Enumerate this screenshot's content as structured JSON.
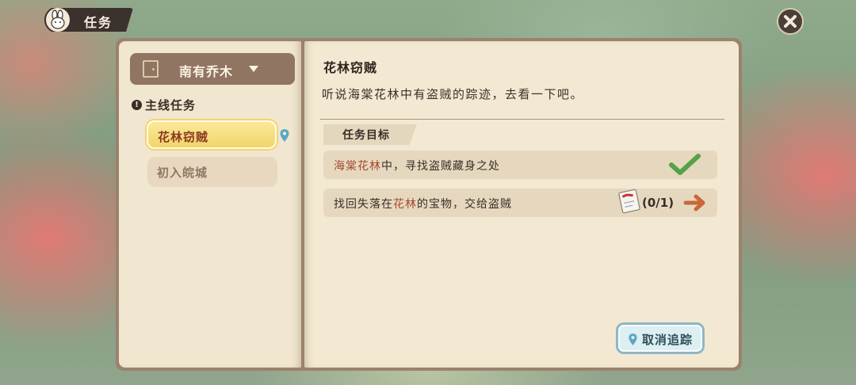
{
  "header": {
    "title": "任务"
  },
  "icons": {
    "header_avatar": "bunny-icon",
    "close": "close-icon",
    "area": "door-icon",
    "dropdown": "caret-down-icon",
    "section": "exclamation-icon",
    "tracked": "location-pin-icon",
    "completed": "checkmark-icon",
    "item": "scroll-icon",
    "go": "arrow-right-icon"
  },
  "colors": {
    "accent_gold": "#f1d56a",
    "check_green": "#58a04a",
    "highlight_red": "#a24a2e",
    "arrow_orange": "#c8683a"
  },
  "sidebar": {
    "area_selector": "南有乔木",
    "section_title": "主线任务",
    "quests": [
      {
        "label": "花林窃贼",
        "selected": true,
        "tracked": true
      },
      {
        "label": "初入皖城",
        "selected": false,
        "tracked": false
      }
    ]
  },
  "detail": {
    "title": "花林窃贼",
    "description": "听说海棠花林中有盗贼的踪迹，去看一下吧。",
    "objectives_label": "任务目标",
    "objectives": [
      {
        "highlight": "海棠花林",
        "rest": "中，寻找盗贼藏身之处",
        "completed": true
      },
      {
        "prefix": "找回失落在",
        "highlight": "花林",
        "suffix": "的宝物，交给盗贼",
        "progress": "(0/1)",
        "completed": false
      }
    ]
  },
  "actions": {
    "untrack_label": "取消追踪"
  }
}
